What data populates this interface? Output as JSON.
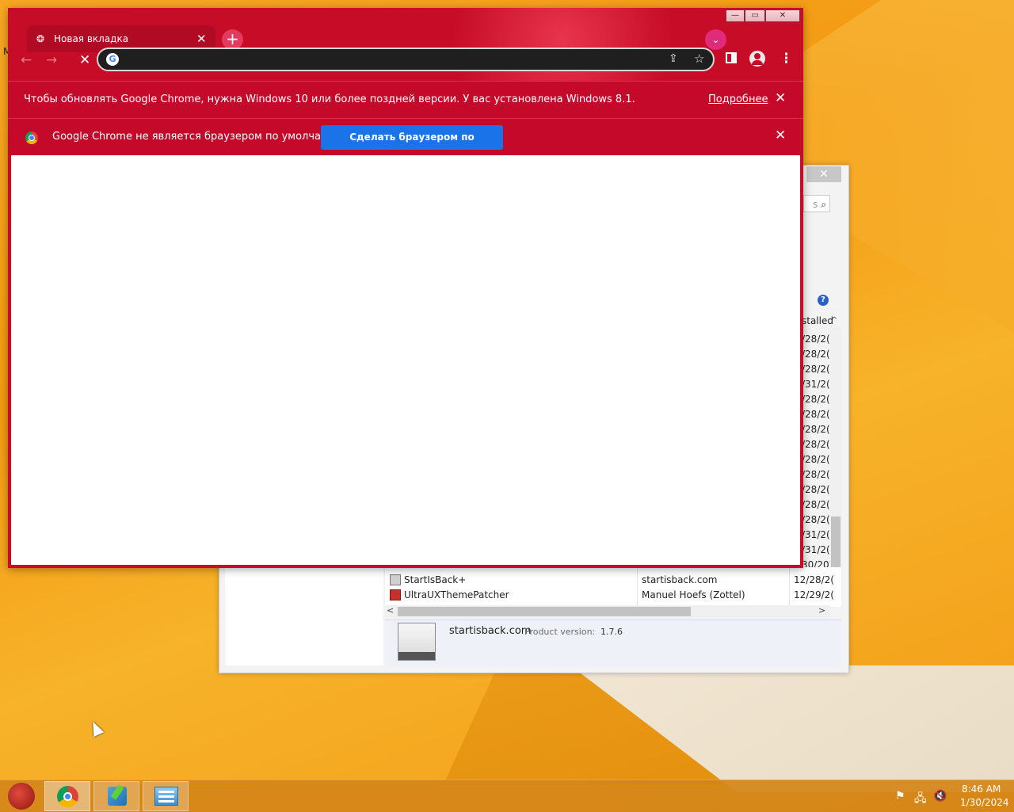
{
  "desktop": {
    "fragment_label": "M"
  },
  "chrome": {
    "tab": {
      "favicon": "tab-loading-icon",
      "title": "Новая вкладка",
      "close": "✕"
    },
    "new_tab_label": "+",
    "tab_search_label": "⌄",
    "window_controls": {
      "minimize": "—",
      "maximize": "▭",
      "close": "✕"
    },
    "nav": {
      "back": "←",
      "forward": "→",
      "stop": "✕"
    },
    "omnibox": {
      "value": "",
      "share": "⇪",
      "star": "☆"
    },
    "menu_label": "⋮",
    "infobars": [
      {
        "text": "Чтобы обновлять Google Chrome, нужна Windows 10 или более поздней версии. У вас установлена Windows 8.1.",
        "link": "Подробнее",
        "close": "✕"
      },
      {
        "text": "Google Chrome не является браузером по умолчанию.",
        "button": "Сделать браузером по умолчанию",
        "close": "✕"
      }
    ],
    "accent_color": "#c60c27",
    "button_color": "#1a73e8"
  },
  "programs": {
    "close": "✕",
    "search_fragment": "s",
    "search_icon": "⌕",
    "help_label": "?",
    "header_fragment": "stalled",
    "sort_arrow": "^",
    "date_fragments": [
      "/28/2(",
      "/28/2(",
      "/28/2(",
      "/31/2(",
      "/28/2(",
      "/28/2(",
      "/28/2(",
      "/28/2(",
      "/28/2(",
      "/28/2(",
      "/28/2(",
      "/28/2(",
      "/28/2(",
      "/31/2(",
      "/31/2(",
      "30/202"
    ],
    "rows": [
      {
        "name": "StartIsBack+",
        "publisher": "startisback.com",
        "installed": "12/28/2("
      },
      {
        "name": "UltraUXThemePatcher",
        "publisher": "Manuel Hoefs (Zottel)",
        "installed": "12/29/2("
      }
    ],
    "hscroll": {
      "left": "<",
      "right": ">"
    },
    "details": {
      "name": "startisback.com",
      "label": "Product version:",
      "value": "1.7.6"
    }
  },
  "taskbar": {
    "tray": {
      "flag": "⚑",
      "network": "🖧",
      "volume": "🔇"
    },
    "time": "8:46 AM",
    "date": "1/30/2024"
  }
}
